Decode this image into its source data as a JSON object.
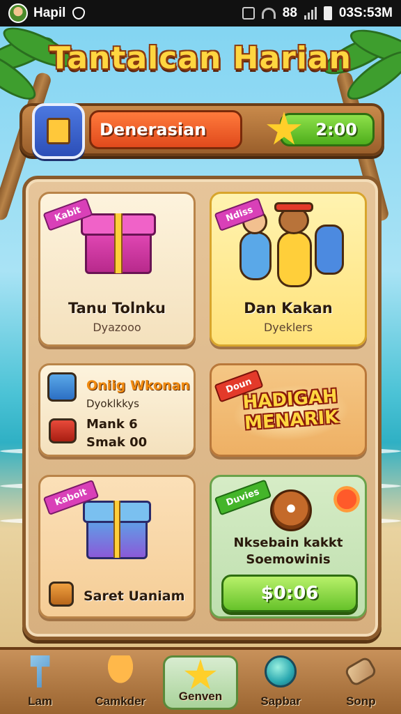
{
  "status_bar": {
    "carrier": "Hapil",
    "signal_label": "88",
    "time": "03S:53M"
  },
  "title": "Tantalcan Harian",
  "top_bar": {
    "category_label": "Denerasian",
    "score": "2:00"
  },
  "cards": [
    {
      "ribbon": "Kabit",
      "title": "Tanu Tolnku",
      "subtitle": "Dyazooo"
    },
    {
      "ribbon": "Ndiss",
      "title": "Dan Kakan",
      "subtitle": "Dyeklers"
    },
    {
      "title": "Oniig Wkonan",
      "lines": [
        "Dyoklkkys",
        "Mank 6",
        "Smak 00"
      ]
    },
    {
      "ribbon": "Doun",
      "banner_line1": "HADIGAH",
      "banner_line2": "MENARIK"
    },
    {
      "ribbon": "Kaboit",
      "title": "Saret Uaniam"
    },
    {
      "ribbon": "Duvies",
      "title_line1": "Nksebain kakkt",
      "title_line2": "Soemowinis",
      "price": "$0:06"
    }
  ],
  "bottom_nav": [
    {
      "label": "Lam",
      "icon": "hammer-icon"
    },
    {
      "label": "Camkder",
      "icon": "mushroom-icon"
    },
    {
      "label": "Genven",
      "icon": "star-icon",
      "active": true
    },
    {
      "label": "Sapbar",
      "icon": "gem-icon"
    },
    {
      "label": "Sonp",
      "icon": "scroll-icon"
    }
  ]
}
